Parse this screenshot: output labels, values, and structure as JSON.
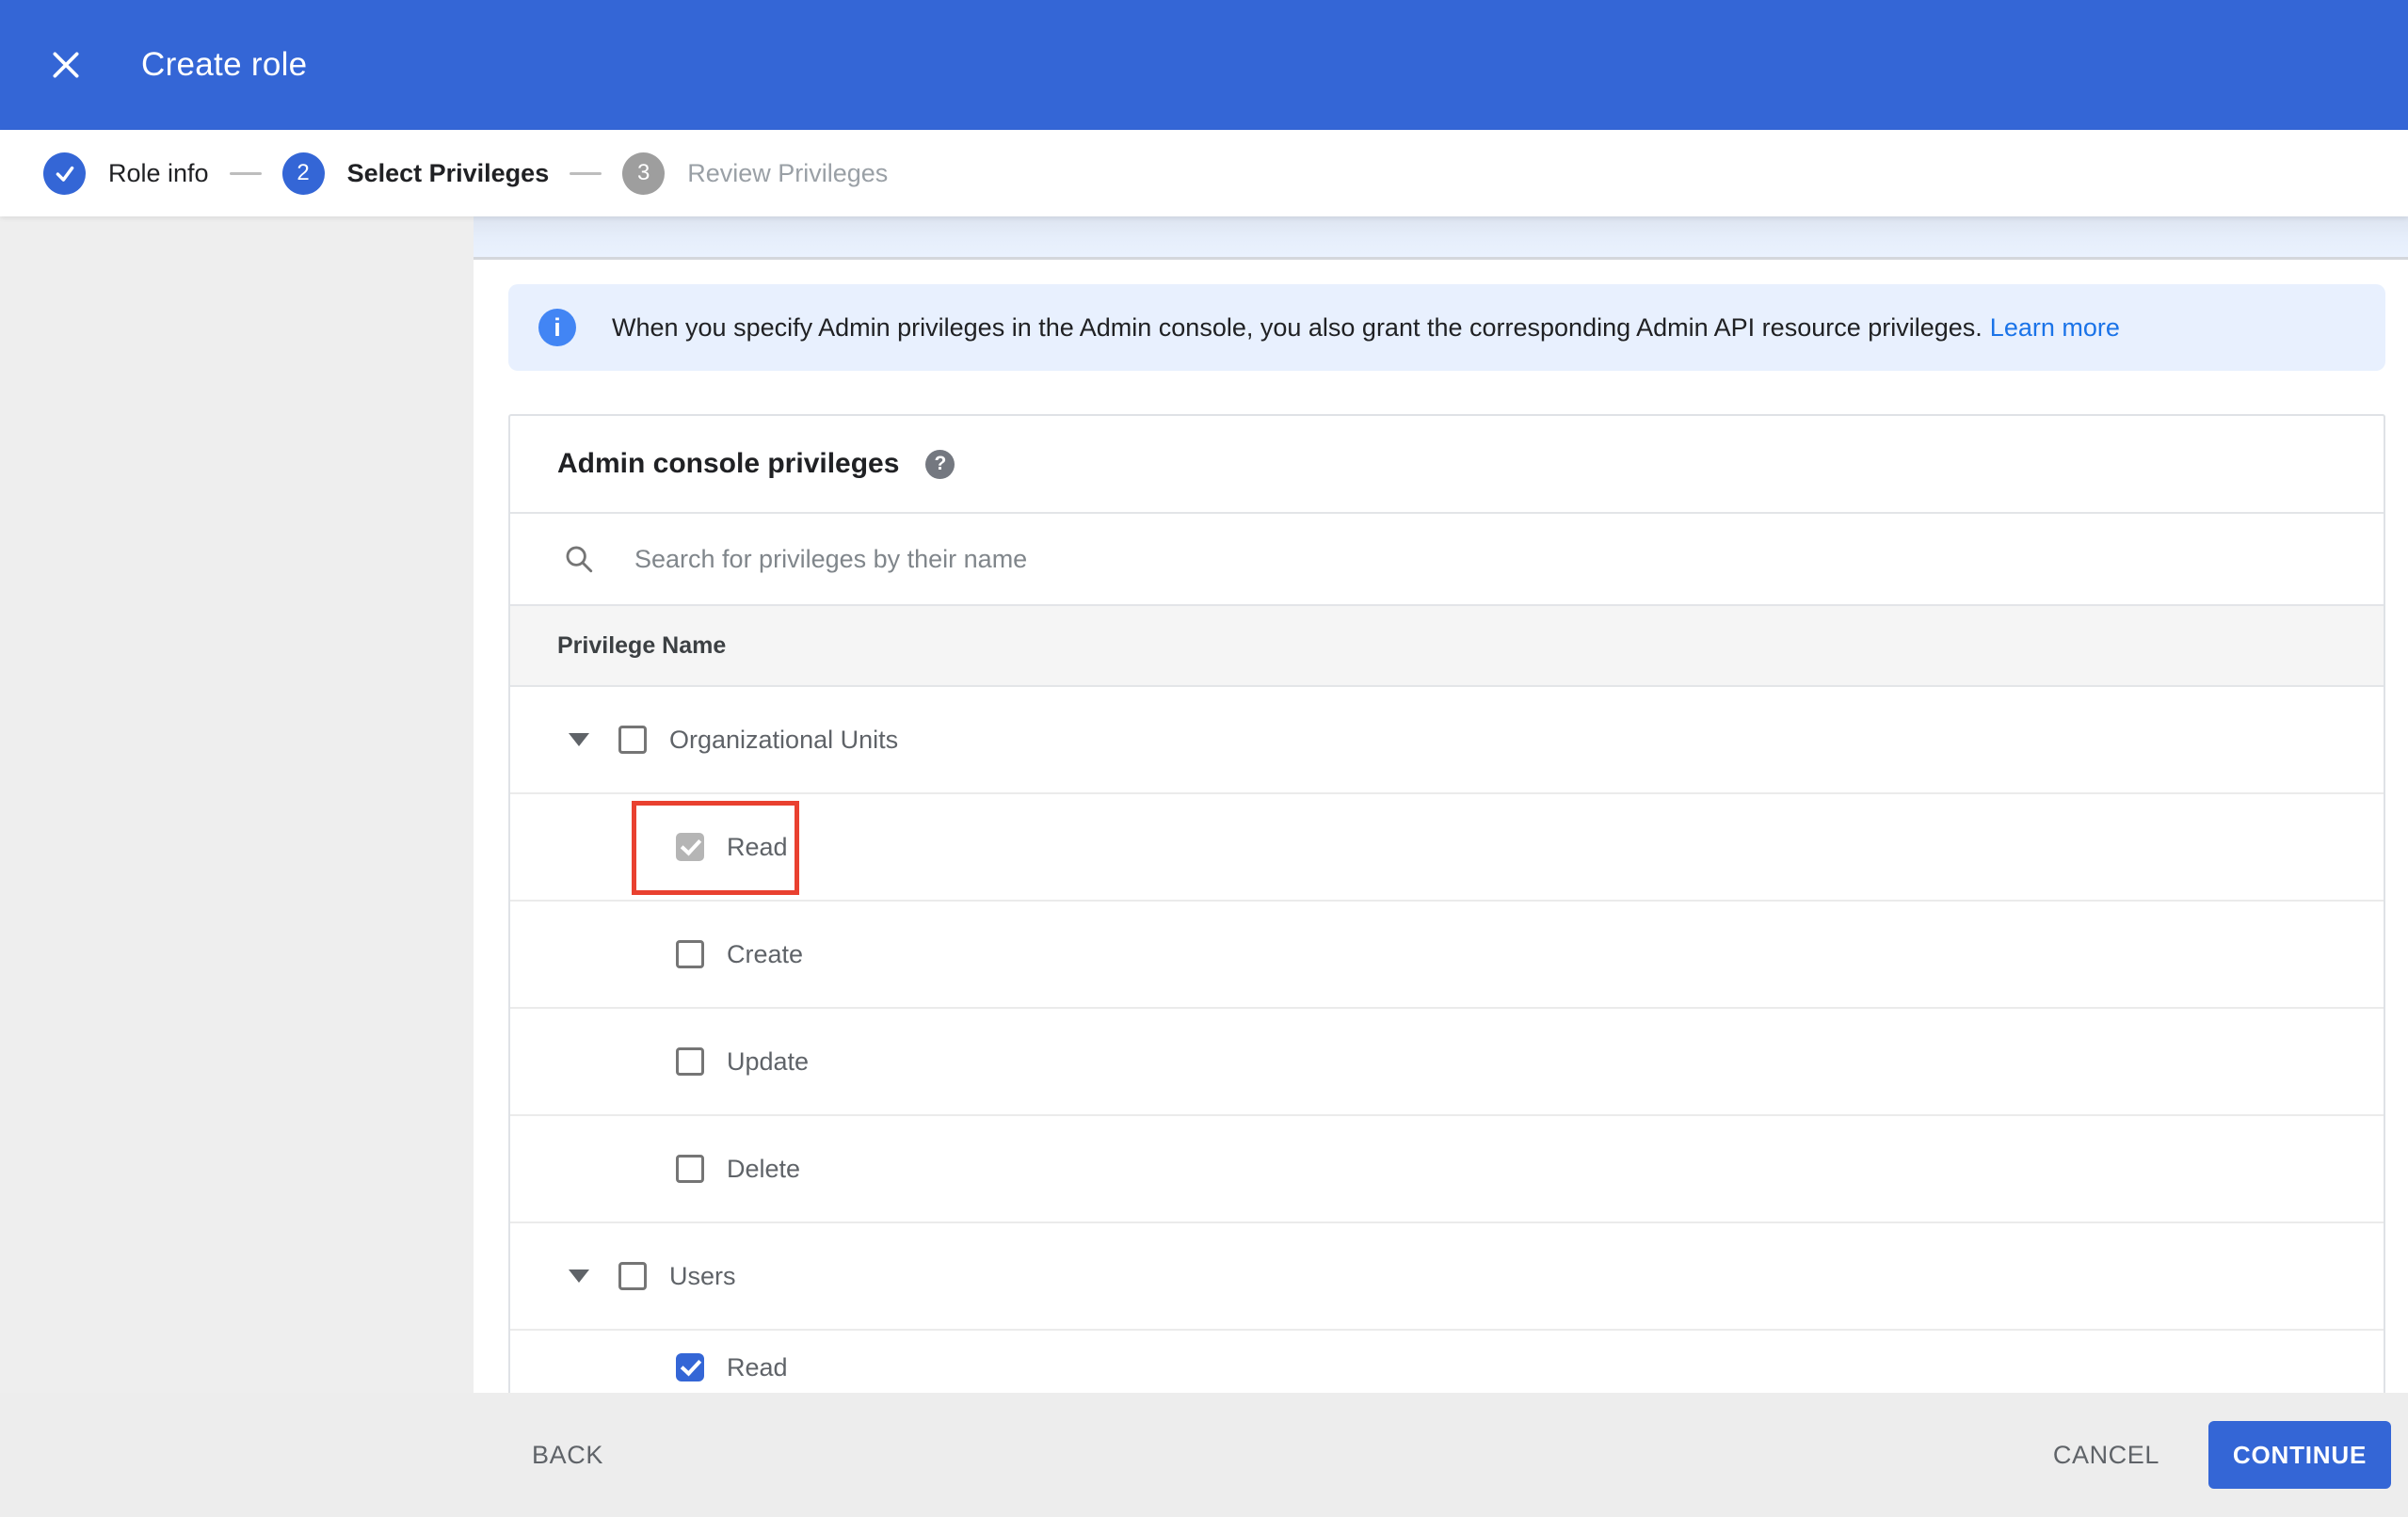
{
  "colors": {
    "primary_blue": "#3466d6",
    "link_blue": "#1a73e8",
    "info_icon_blue": "#4285f4",
    "banner_background": "#e8f0fe",
    "highlight_red": "#e94130",
    "step_inactive_gray": "#9e9e9e"
  },
  "header": {
    "title": "Create role"
  },
  "stepper": {
    "steps": [
      {
        "number": "1",
        "label": "Role info",
        "state": "done"
      },
      {
        "number": "2",
        "label": "Select Privileges",
        "state": "active"
      },
      {
        "number": "3",
        "label": "Review Privileges",
        "state": "todo"
      }
    ]
  },
  "banner": {
    "text": "When you specify Admin privileges in the Admin console, you also grant the corresponding Admin API resource privileges.",
    "link_label": "Learn more"
  },
  "privileges_card": {
    "title": "Admin console privileges",
    "help_icon": "?",
    "search_placeholder": "Search for privileges by their name",
    "search_value": "",
    "column_header": "Privilege Name",
    "rows": [
      {
        "label": "Organizational Units",
        "level": "parent",
        "expanded": true,
        "checked": false
      },
      {
        "label": "Read",
        "level": "child",
        "checked": true,
        "checkbox_style": "gray-checked",
        "highlighted": true
      },
      {
        "label": "Create",
        "level": "child",
        "checked": false
      },
      {
        "label": "Update",
        "level": "child",
        "checked": false
      },
      {
        "label": "Delete",
        "level": "child",
        "checked": false
      },
      {
        "label": "Users",
        "level": "parent",
        "expanded": true,
        "checked": false
      },
      {
        "label": "Read",
        "level": "child",
        "checked": true,
        "checkbox_style": "blue-checked",
        "clipped": true
      }
    ]
  },
  "footer": {
    "back_label": "BACK",
    "cancel_label": "CANCEL",
    "continue_label": "CONTINUE"
  }
}
